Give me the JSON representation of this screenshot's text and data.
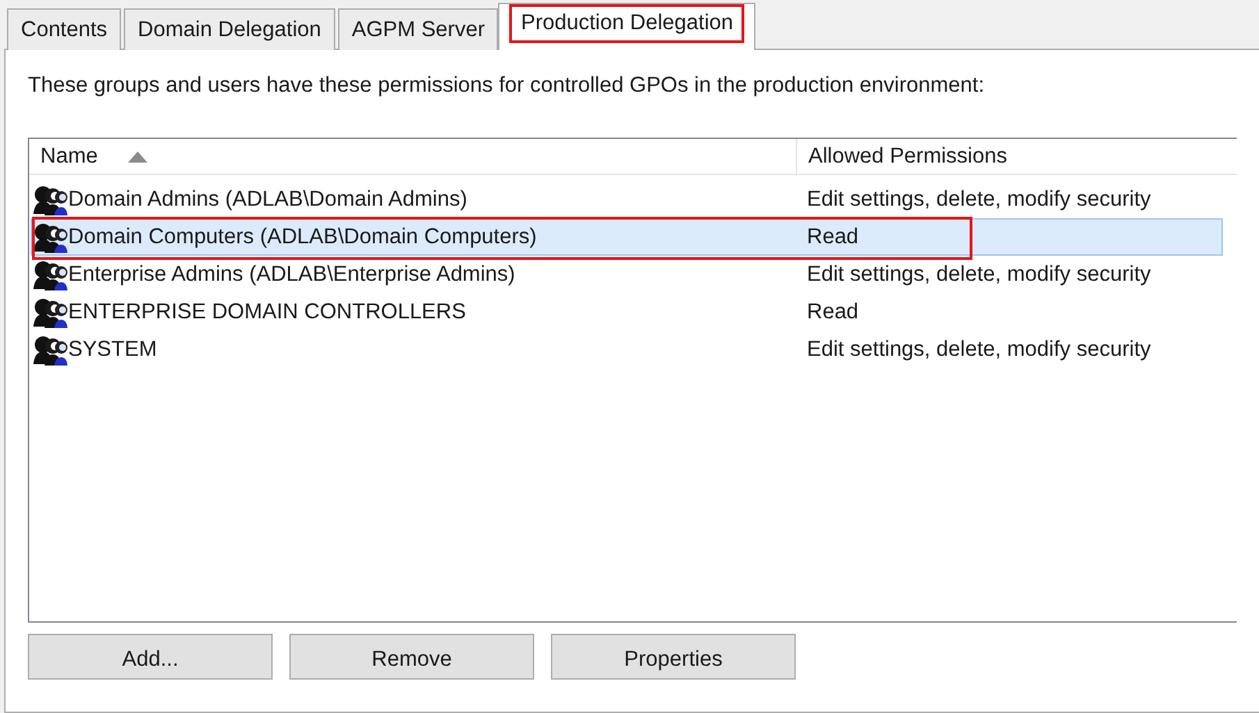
{
  "tabs": [
    {
      "label": "Contents",
      "selected": false,
      "highlighted": false
    },
    {
      "label": "Domain Delegation",
      "selected": false,
      "highlighted": false
    },
    {
      "label": "AGPM Server",
      "selected": false,
      "highlighted": false
    },
    {
      "label": "Production Delegation",
      "selected": true,
      "highlighted": true
    }
  ],
  "description": "These groups and users have these permissions for controlled GPOs in the production environment:",
  "table": {
    "columns": [
      {
        "label": "Name",
        "sort_ascending": true
      },
      {
        "label": "Allowed Permissions"
      }
    ],
    "rows": [
      {
        "name": "Domain Admins (ADLAB\\Domain Admins)",
        "permissions": "Edit settings, delete, modify security",
        "selected": false,
        "highlighted": false
      },
      {
        "name": "Domain Computers (ADLAB\\Domain Computers)",
        "permissions": "Read",
        "selected": true,
        "highlighted": true
      },
      {
        "name": "Enterprise Admins (ADLAB\\Enterprise Admins)",
        "permissions": "Edit settings, delete, modify security",
        "selected": false,
        "highlighted": false
      },
      {
        "name": "ENTERPRISE DOMAIN CONTROLLERS",
        "permissions": "Read",
        "selected": false,
        "highlighted": false
      },
      {
        "name": "SYSTEM",
        "permissions": "Edit settings, delete, modify security",
        "selected": false,
        "highlighted": false
      }
    ]
  },
  "buttons": [
    "Add...",
    "Remove",
    "Properties"
  ]
}
